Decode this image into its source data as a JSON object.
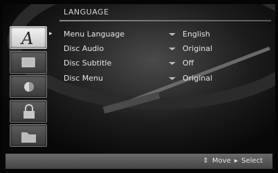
{
  "menu": {
    "title": "LANGUAGE",
    "rows": [
      {
        "label": "Menu Language",
        "value": "English"
      },
      {
        "label": "Disc Audio",
        "value": "Original"
      },
      {
        "label": "Disc Subtitle",
        "value": "Off"
      },
      {
        "label": "Disc Menu",
        "value": "Original"
      }
    ]
  },
  "sidebar": {
    "tabs": [
      {
        "icon": "language-a-icon",
        "active": true
      },
      {
        "icon": "display-screen-icon",
        "active": false
      },
      {
        "icon": "audio-speaker-icon",
        "active": false
      },
      {
        "icon": "lock-icon",
        "active": false
      },
      {
        "icon": "other-folder-icon",
        "active": false
      }
    ],
    "active_arrow": "▸"
  },
  "footer": {
    "move_symbol": "⇕",
    "move_label": "Move",
    "select_symbol": "▸",
    "select_label": "Select"
  },
  "colors": {
    "background": "#0b0b0b",
    "text": "#e6e6e6",
    "active_tab": "#e8e8e8",
    "inactive_tab": "#4a4a4a",
    "footer_bar": "#5a5a5a"
  }
}
